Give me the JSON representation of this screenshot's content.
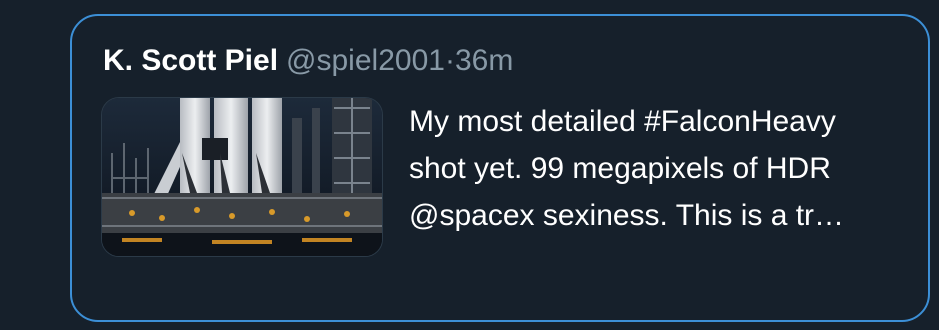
{
  "tweet": {
    "display_name": "K. Scott Piel",
    "handle": "@spiel2001",
    "separator": "·",
    "time": "36m",
    "text_lines": [
      "My most detailed #FalconHeavy",
      "shot yet. 99 megapixels of HDR",
      "@spacex sexiness. This is a tr…"
    ],
    "media": {
      "icon": "rocket-photo-thumbnail",
      "description_icon": "image-icon"
    }
  },
  "colors": {
    "background": "#16202b",
    "border_accent": "#3c8fd6",
    "text_primary": "#ffffff",
    "text_secondary": "#8899a6"
  }
}
